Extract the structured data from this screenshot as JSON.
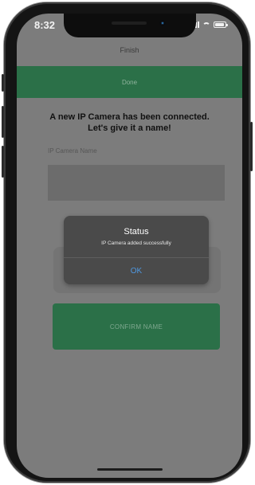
{
  "status_bar": {
    "time": "8:32"
  },
  "nav": {
    "title": "Finish",
    "done_label": "Done"
  },
  "main": {
    "heading_line1": "A new IP Camera has been connected.",
    "heading_line2": "Let's give it a name!",
    "field_label": "IP Camera Name",
    "field_value": "",
    "confirm_label": "CONFIRM NAME"
  },
  "alert": {
    "title": "Status",
    "message": "IP Camera added successfully",
    "ok_label": "OK"
  },
  "colors": {
    "accent_green": "#2b7048",
    "overlay_gray": "#7c7c7c",
    "link_blue": "#4f98e0"
  }
}
